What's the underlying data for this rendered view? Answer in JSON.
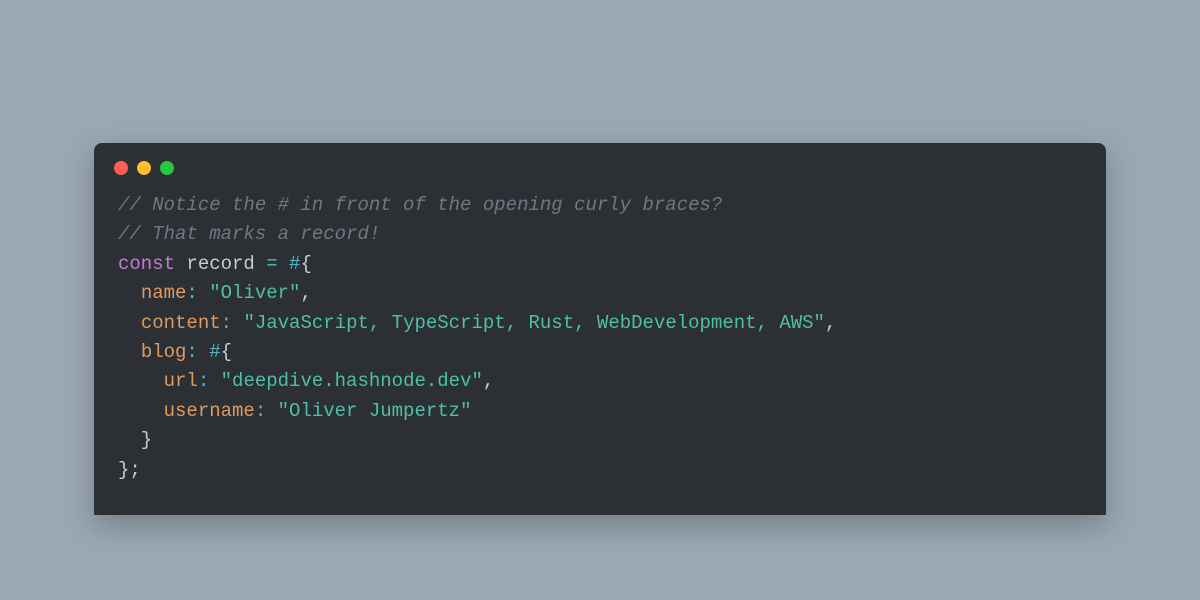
{
  "colors": {
    "bg": "#9aa8b4",
    "window": "#2c2f33",
    "red": "#ff5f56",
    "yellow": "#ffbd2e",
    "green": "#27c93f",
    "comment": "#6f7884",
    "keyword": "#c678dd",
    "operator": "#56b6c2",
    "key": "#de9a63",
    "string": "#4fbfa8",
    "default": "#c9ccd1"
  },
  "code": {
    "comment1": "// Notice the # in front of the opening curly braces?",
    "comment2": "// That marks a record!",
    "kw_const": "const",
    "var_record": " record ",
    "op_eq": "=",
    "sp1": " ",
    "hash1": "#",
    "brace_open1": "{",
    "indent1": "  ",
    "key_name": "name",
    "colon": ":",
    "sp2": " ",
    "str_name": "\"Oliver\"",
    "comma": ",",
    "key_content": "content",
    "str_content": "\"JavaScript, TypeScript, Rust, WebDevelopment, AWS\"",
    "key_blog": "blog",
    "hash2": "#",
    "brace_open2": "{",
    "indent2": "    ",
    "key_url": "url",
    "str_url": "\"deepdive.hashnode.dev\"",
    "key_username": "username",
    "str_username": "\"Oliver Jumpertz\"",
    "brace_close2": "  }",
    "brace_close1": "}",
    "semi": ";"
  }
}
